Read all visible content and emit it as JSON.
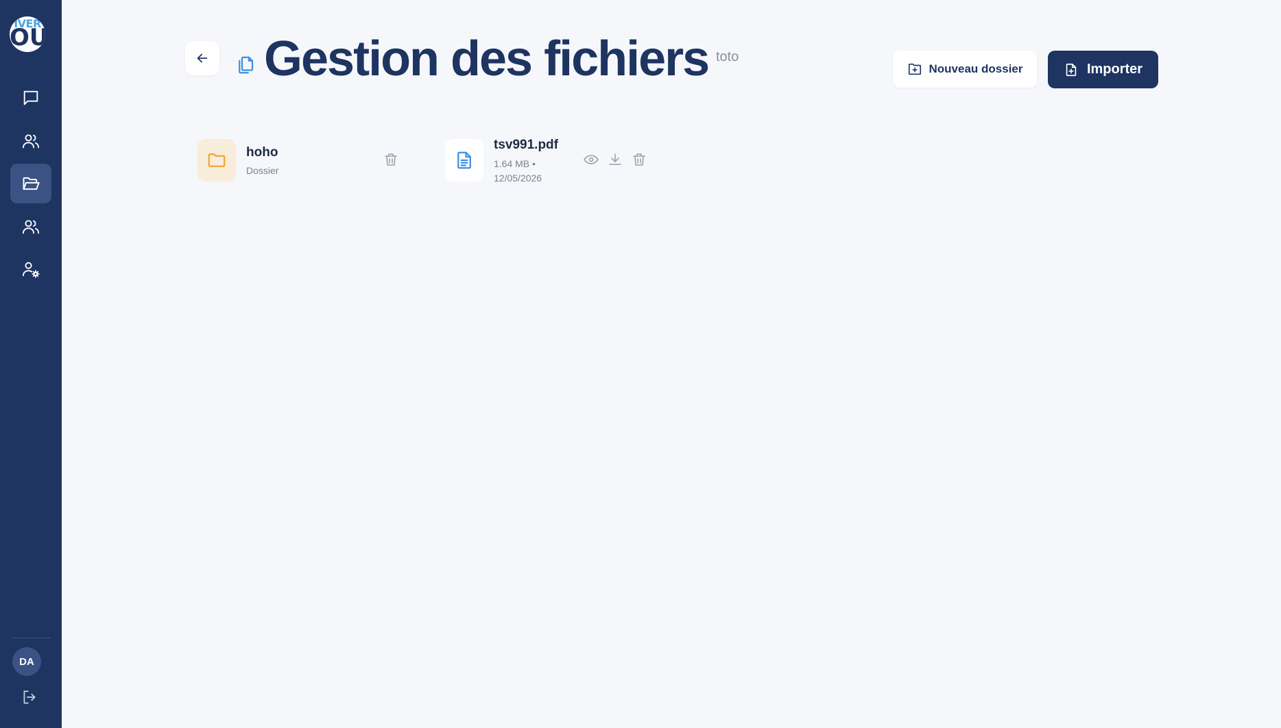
{
  "sidebar": {
    "logo_text_top": "IVER",
    "logo_text_bottom": "OU",
    "nav": [
      {
        "icon": "chat-icon",
        "active": false
      },
      {
        "icon": "users-icon",
        "active": false
      },
      {
        "icon": "folder-open-icon",
        "active": true
      },
      {
        "icon": "users-icon",
        "active": false
      },
      {
        "icon": "user-settings-icon",
        "active": false
      }
    ],
    "user_initials": "DA",
    "logout_icon": "logout-icon"
  },
  "header": {
    "title": "Gestion des fichiers",
    "subtitle": "toto",
    "new_folder_label": "Nouveau dossier",
    "import_label": "Importer"
  },
  "items": [
    {
      "type": "folder",
      "name": "hoho",
      "meta": "Dossier"
    },
    {
      "type": "file",
      "name": "tsv991.pdf",
      "meta_line1": "1.64 MB •",
      "meta_line2": "12/05/2026"
    }
  ],
  "colors": {
    "primary": "#1e3461",
    "background": "#f5f7fb",
    "folder_accent": "#f3a533",
    "file_accent": "#3b8fe0"
  }
}
